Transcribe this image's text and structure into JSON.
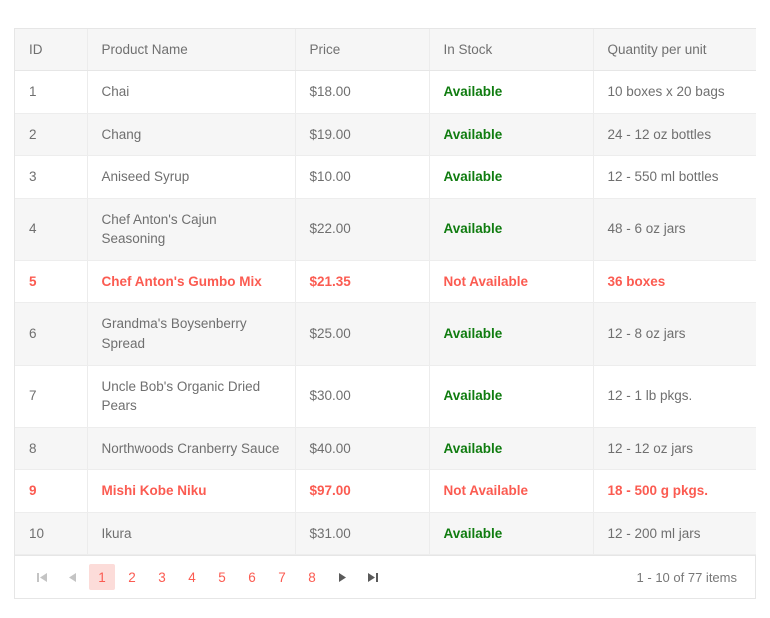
{
  "grid": {
    "columns": [
      {
        "key": "id",
        "label": "ID"
      },
      {
        "key": "name",
        "label": "Product Name"
      },
      {
        "key": "price",
        "label": "Price"
      },
      {
        "key": "stock",
        "label": "In Stock"
      },
      {
        "key": "qty",
        "label": "Quantity per unit"
      }
    ],
    "rows": [
      {
        "id": "1",
        "name": "Chai",
        "price": "$18.00",
        "stock": "Available",
        "qty": "10 boxes x 20 bags",
        "flagged": false
      },
      {
        "id": "2",
        "name": "Chang",
        "price": "$19.00",
        "stock": "Available",
        "qty": "24 - 12 oz bottles",
        "flagged": false
      },
      {
        "id": "3",
        "name": "Aniseed Syrup",
        "price": "$10.00",
        "stock": "Available",
        "qty": "12 - 550 ml bottles",
        "flagged": false
      },
      {
        "id": "4",
        "name": "Chef Anton's Cajun Seasoning",
        "price": "$22.00",
        "stock": "Available",
        "qty": "48 - 6 oz jars",
        "flagged": false
      },
      {
        "id": "5",
        "name": "Chef Anton's Gumbo Mix",
        "price": "$21.35",
        "stock": "Not Available",
        "qty": "36 boxes",
        "flagged": true
      },
      {
        "id": "6",
        "name": "Grandma's Boysenberry Spread",
        "price": "$25.00",
        "stock": "Available",
        "qty": "12 - 8 oz jars",
        "flagged": false
      },
      {
        "id": "7",
        "name": "Uncle Bob's Organic Dried Pears",
        "price": "$30.00",
        "stock": "Available",
        "qty": "12 - 1 lb pkgs.",
        "flagged": false
      },
      {
        "id": "8",
        "name": "Northwoods Cranberry Sauce",
        "price": "$40.00",
        "stock": "Available",
        "qty": "12 - 12 oz jars",
        "flagged": false
      },
      {
        "id": "9",
        "name": "Mishi Kobe Niku",
        "price": "$97.00",
        "stock": "Not Available",
        "qty": "18 - 500 g pkgs.",
        "flagged": true
      },
      {
        "id": "10",
        "name": "Ikura",
        "price": "$31.00",
        "stock": "Available",
        "qty": "12 - 200 ml jars",
        "flagged": false
      }
    ]
  },
  "pager": {
    "first_icon": "first-page-icon",
    "prev_icon": "previous-page-icon",
    "next_icon": "next-page-icon",
    "last_icon": "last-page-icon",
    "pages": [
      "1",
      "2",
      "3",
      "4",
      "5",
      "6",
      "7",
      "8"
    ],
    "active_page": "1",
    "info": "1 - 10 of 77 items"
  },
  "colors": {
    "accent": "#fb5b51",
    "accent_bg": "#fcdcd9",
    "available": "#107c10",
    "header_bg": "#f6f6f6",
    "alt_row_bg": "#f6f6f6",
    "border": "#e6e6e6",
    "text": "#6f6f6f",
    "arrow_disabled": "#c4c4c4",
    "arrow_enabled": "#5a5a5a"
  }
}
